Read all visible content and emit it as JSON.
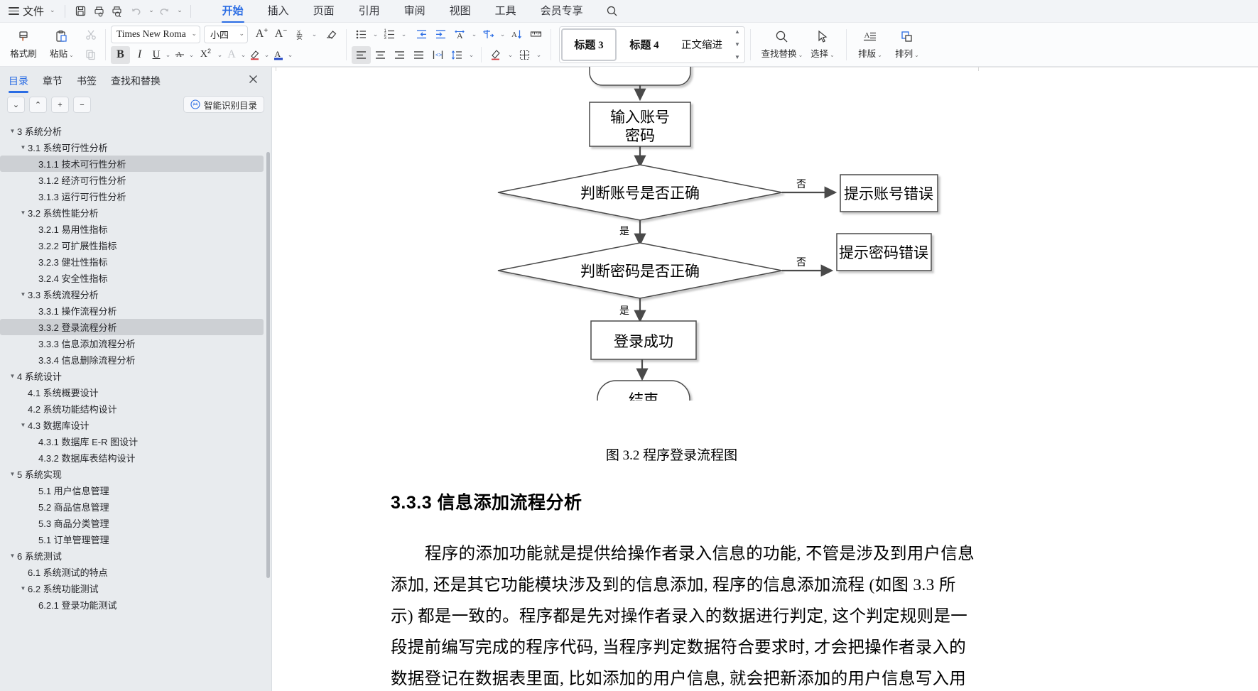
{
  "menubar": {
    "file_label": "文件",
    "icons": [
      "save-icon",
      "print-preview-icon",
      "print-search-icon",
      "undo-icon",
      "redo-icon",
      "more-icon"
    ],
    "tabs": [
      {
        "label": "开始",
        "active": true
      },
      {
        "label": "插入",
        "active": false
      },
      {
        "label": "页面",
        "active": false
      },
      {
        "label": "引用",
        "active": false
      },
      {
        "label": "审阅",
        "active": false
      },
      {
        "label": "视图",
        "active": false
      },
      {
        "label": "工具",
        "active": false
      },
      {
        "label": "会员专享",
        "active": false
      }
    ],
    "search_icon": "search-icon"
  },
  "ribbon": {
    "format_painter": "格式刷",
    "paste": "粘贴",
    "cut_icon": "scissors-icon",
    "copy_icon": "copy-icon",
    "font_name": "Times New Roma",
    "font_size": "小四",
    "grow_font": "A+",
    "shrink_font": "A−",
    "phonetic_icon": "phonetic-guide-icon",
    "clear_format_icon": "clear-format-icon",
    "bold": "B",
    "italic": "I",
    "underline": "U",
    "strikethrough_icon": "strikethrough-icon",
    "superscript": "X²",
    "text_effect": "A",
    "highlight_icon": "highlight-icon",
    "font_color": "A",
    "bullets_icon": "bullet-list-icon",
    "numbering_icon": "numbered-list-icon",
    "decrease_indent_icon": "decrease-indent-icon",
    "increase_indent_icon": "increase-indent-icon",
    "pinyin_icon": "text-direction-icon",
    "show_marks_icon": "show-paragraph-marks-icon",
    "sort_icon": "sort-icon",
    "ruler_icon": "ruler-icon",
    "align_left_icon": "align-left-icon",
    "align_center_icon": "align-center-icon",
    "align_right_icon": "align-right-icon",
    "align_justify_icon": "align-justify-icon",
    "distribute_icon": "distribute-text-icon",
    "line_spacing_icon": "line-spacing-icon",
    "shading_icon": "shading-icon",
    "borders_icon": "borders-icon",
    "styles": [
      {
        "label": "标题 3",
        "selected": true
      },
      {
        "label": "标题 4",
        "selected": false
      },
      {
        "label": "正文缩进",
        "selected": false
      }
    ],
    "find_replace": "查找替换",
    "select": "选择",
    "typeset": "排版",
    "arrange": "排列"
  },
  "sidebar": {
    "tabs": [
      {
        "label": "目录",
        "active": true
      },
      {
        "label": "章节",
        "active": false
      },
      {
        "label": "书签",
        "active": false
      },
      {
        "label": "查找和替换",
        "active": false
      }
    ],
    "close_icon": "close-icon",
    "toolbar_buttons": [
      {
        "name": "collapse-down-button",
        "glyph": "⌄"
      },
      {
        "name": "collapse-up-button",
        "glyph": "⌃"
      },
      {
        "name": "expand-level-button",
        "glyph": "+"
      },
      {
        "name": "collapse-level-button",
        "glyph": "−"
      }
    ],
    "smart_toc_label": "智能识别目录",
    "tree": [
      {
        "level": 0,
        "arrow": "▼",
        "label": "3  系统分析",
        "selected": false
      },
      {
        "level": 1,
        "arrow": "▼",
        "label": "3.1  系统可行性分析",
        "selected": false
      },
      {
        "level": 2,
        "arrow": "",
        "label": "3.1.1  技术可行性分析",
        "selected": true
      },
      {
        "level": 2,
        "arrow": "",
        "label": "3.1.2  经济可行性分析",
        "selected": false
      },
      {
        "level": 2,
        "arrow": "",
        "label": "3.1.3  运行可行性分析",
        "selected": false
      },
      {
        "level": 1,
        "arrow": "▼",
        "label": "3.2  系统性能分析",
        "selected": false
      },
      {
        "level": 2,
        "arrow": "",
        "label": "3.2.1  易用性指标",
        "selected": false
      },
      {
        "level": 2,
        "arrow": "",
        "label": "3.2.2  可扩展性指标",
        "selected": false
      },
      {
        "level": 2,
        "arrow": "",
        "label": "3.2.3  健壮性指标",
        "selected": false
      },
      {
        "level": 2,
        "arrow": "",
        "label": "3.2.4  安全性指标",
        "selected": false
      },
      {
        "level": 1,
        "arrow": "▼",
        "label": "3.3  系统流程分析",
        "selected": false
      },
      {
        "level": 2,
        "arrow": "",
        "label": "3.3.1  操作流程分析",
        "selected": false
      },
      {
        "level": 2,
        "arrow": "",
        "label": "3.3.2  登录流程分析",
        "selected": true
      },
      {
        "level": 2,
        "arrow": "",
        "label": "3.3.3  信息添加流程分析",
        "selected": false
      },
      {
        "level": 2,
        "arrow": "",
        "label": "3.3.4  信息删除流程分析",
        "selected": false
      },
      {
        "level": 0,
        "arrow": "▼",
        "label": "4  系统设计",
        "selected": false
      },
      {
        "level": 1,
        "arrow": "",
        "label": "4.1  系统概要设计",
        "selected": false
      },
      {
        "level": 1,
        "arrow": "",
        "label": "4.2  系统功能结构设计",
        "selected": false
      },
      {
        "level": 1,
        "arrow": "▼",
        "label": "4.3  数据库设计",
        "selected": false
      },
      {
        "level": 2,
        "arrow": "",
        "label": "4.3.1  数据库 E-R 图设计",
        "selected": false
      },
      {
        "level": 2,
        "arrow": "",
        "label": "4.3.2  数据库表结构设计",
        "selected": false
      },
      {
        "level": 0,
        "arrow": "▼",
        "label": "5  系统实现",
        "selected": false
      },
      {
        "level": 2,
        "arrow": "",
        "label": "5.1 用户信息管理",
        "selected": false
      },
      {
        "level": 2,
        "arrow": "",
        "label": "5.2  商品信息管理",
        "selected": false
      },
      {
        "level": 2,
        "arrow": "",
        "label": "5.3 商品分类管理",
        "selected": false
      },
      {
        "level": 2,
        "arrow": "",
        "label": "5.1 订单管理管理",
        "selected": false
      },
      {
        "level": 0,
        "arrow": "▼",
        "label": "6  系统测试",
        "selected": false
      },
      {
        "level": 1,
        "arrow": "",
        "label": "6.1  系统测试的特点",
        "selected": false
      },
      {
        "level": 1,
        "arrow": "▼",
        "label": "6.2  系统功能测试",
        "selected": false
      },
      {
        "level": 2,
        "arrow": "",
        "label": "6.2.1  登录功能测试",
        "selected": false
      }
    ]
  },
  "document": {
    "flowchart": {
      "nodes": {
        "input": "输入账号\n密码",
        "check_account": "判断账号是否正确",
        "account_error": "提示账号错误",
        "check_password": "判断密码是否正确",
        "password_error": "提示密码错误",
        "login_success": "登录成功",
        "end": "结束"
      },
      "input_line1": "输入账号",
      "input_line2": "密码",
      "check_account": "判断账号是否正确",
      "account_error": "提示账号错误",
      "check_password": "判断密码是否正确",
      "password_error": "提示密码错误",
      "login_success": "登录成功",
      "end": "结束",
      "label_no_1": "否",
      "label_yes_1": "是",
      "label_no_2": "否",
      "label_yes_2": "是"
    },
    "figure_caption": "图 3.2  程序登录流程图",
    "heading": "3.3.3  信息添加流程分析",
    "paragraph_lines": [
      "程序的添加功能就是提供给操作者录入信息的功能, 不管是涉及到用户信息",
      "添加, 还是其它功能模块涉及到的信息添加, 程序的信息添加流程 (如图 3.3 所",
      "示) 都是一致的。程序都是先对操作者录入的数据进行判定, 这个判定规则是一",
      "段提前编写完成的程序代码, 当程序判定数据符合要求时, 才会把操作者录入的",
      "数据登记在数据表里面, 比如添加的用户信息, 就会把新添加的用户信息写入用"
    ]
  }
}
